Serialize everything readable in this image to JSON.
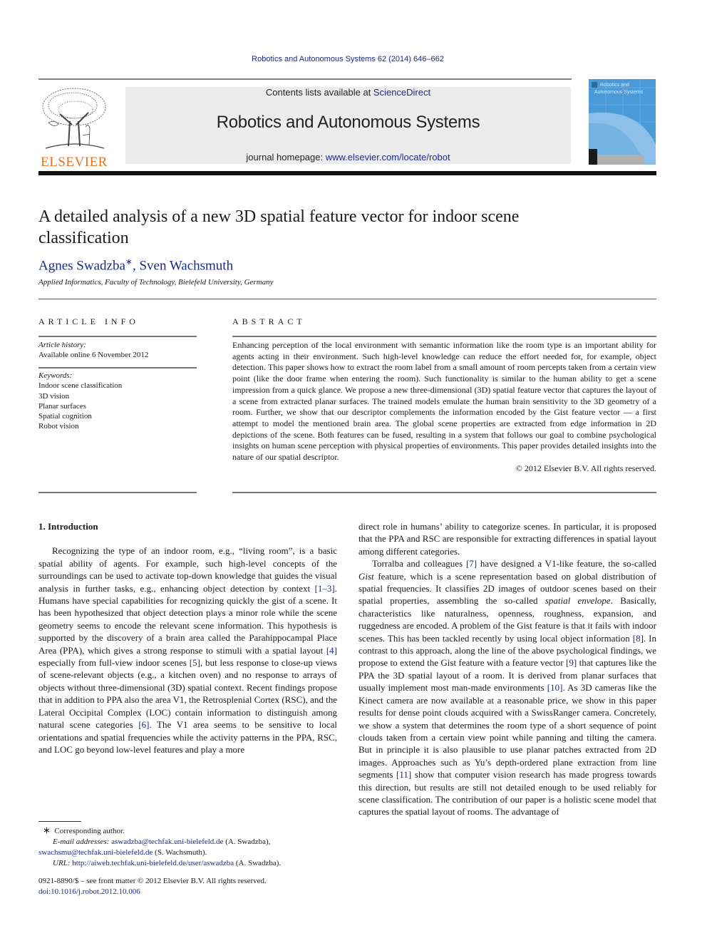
{
  "header": {
    "journal_reference": "Robotics and Autonomous Systems 62 (2014) 646–662",
    "contents_prefix": "Contents lists available at ",
    "contents_link": "ScienceDirect",
    "journal_title": "Robotics and Autonomous Systems",
    "homepage_prefix": "journal homepage: ",
    "homepage_link": "www.elsevier.com/locate/robot",
    "publisher_logo_text": "ELSEVIER",
    "cover_title_line1": "Robotics and",
    "cover_title_line2": "Autonomous Systems"
  },
  "article": {
    "title": "A detailed analysis of a new 3D spatial feature vector for indoor scene classification",
    "authors": [
      {
        "name": "Agnes Swadzba",
        "mark": "∗"
      },
      {
        "name": "Sven Wachsmuth",
        "mark": ""
      }
    ],
    "author_separator": ", ",
    "affiliation": "Applied Informatics, Faculty of Technology, Bielefeld University, Germany"
  },
  "article_info": {
    "heading": "ARTICLE INFO",
    "history_label": "Article history:",
    "history_value": "Available online 6 November 2012",
    "keywords_label": "Keywords:",
    "keywords": [
      "Indoor scene classification",
      "3D vision",
      "Planar surfaces",
      "Spatial cognition",
      "Robot vision"
    ]
  },
  "abstract": {
    "heading": "ABSTRACT",
    "text": "Enhancing perception of the local environment with semantic information like the room type is an important ability for agents acting in their environment. Such high-level knowledge can reduce the effort needed for, for example, object detection. This paper shows how to extract the room label from a small amount of room percepts taken from a certain view point (like the door frame when entering the room). Such functionality is similar to the human ability to get a scene impression from a quick glance. We propose a new three-dimensional (3D) spatial feature vector that captures the layout of a scene from extracted planar surfaces. The trained models emulate the human brain sensitivity to the 3D geometry of a room. Further, we show that our descriptor complements the information encoded by the Gist feature vector — a first attempt to model the mentioned brain area. The global scene properties are extracted from edge information in 2D depictions of the scene. Both features can be fused, resulting in a system that follows our goal to combine psychological insights on human scene perception with physical properties of environments. This paper provides detailed insights into the nature of our spatial descriptor.",
    "copyright": "© 2012 Elsevier B.V. All rights reserved."
  },
  "body": {
    "section_title": "1.  Introduction",
    "left_paragraph": [
      {
        "t": "Recognizing the type of an indoor room, e.g., “living room”, is a basic spatial ability of agents. For example, such high-level concepts of the surroundings can be used to activate top-down knowledge that guides the visual analysis in further tasks, e.g., enhancing object detection by context "
      },
      {
        "r": "[1–3]"
      },
      {
        "t": ". Humans have special capabilities for recognizing quickly the gist of a scene. It has been hypothesized that object detection plays a minor role while the scene geometry seems to encode the relevant scene information. This hypothesis is supported by the discovery of a brain area called the Parahippocampal Place Area (PPA), which gives a strong response to stimuli with a spatial layout "
      },
      {
        "r": "[4]"
      },
      {
        "t": " especially from full-view indoor scenes "
      },
      {
        "r": "[5]"
      },
      {
        "t": ", but less response to close-up views of scene-relevant objects (e.g., a kitchen oven) and no response to arrays of objects without three-dimensional (3D) spatial context. Recent findings propose that in addition to PPA also the area V1, the Retrosplenial Cortex (RSC), and the Lateral Occipital Complex (LOC) contain information to distinguish among natural scene categories "
      },
      {
        "r": "[6]"
      },
      {
        "t": ". The V1 area seems to be sensitive to local orientations and spatial frequencies while the activity patterns in the PPA, RSC, and LOC go beyond low-level features and play a more"
      }
    ],
    "right_paragraph_1": "direct role in humans’ ability to categorize scenes. In particular, it is proposed that the PPA and RSC are responsible for extracting differences in spatial layout among different categories.",
    "right_paragraph_2": [
      {
        "t": "Torralba and colleagues "
      },
      {
        "r": "[7]"
      },
      {
        "t": " have designed a V1-like feature, the so-called "
      },
      {
        "i": "Gist"
      },
      {
        "t": " feature, which is a scene representation based on global distribution of spatial frequencies. It classifies 2D images of outdoor scenes based on their spatial properties, assembling the so-called "
      },
      {
        "i": "spatial envelope"
      },
      {
        "t": ". Basically, characteristics like naturalness, openness, roughness, expansion, and ruggedness are encoded. A problem of the Gist feature is that it fails with indoor scenes. This has been tackled recently by using local object information "
      },
      {
        "r": "[8]"
      },
      {
        "t": ". In contrast to this approach, along the line of the above psychological findings, we propose to extend the Gist feature with a feature vector "
      },
      {
        "r": "[9]"
      },
      {
        "t": " that captures like the PPA the 3D spatial layout of a room. It is derived from planar surfaces that usually implement most man-made environments "
      },
      {
        "r": "[10]"
      },
      {
        "t": ". As 3D cameras like the Kinect camera are now available at a reasonable price, we show in this paper results for dense point clouds acquired with a SwissRanger camera. Concretely, we show a system that determines the room type of a short sequence of point clouds taken from a certain view point while panning and tilting the camera. But in principle it is also plausible to use planar patches extracted from 2D images. Approaches such as Yu’s depth-ordered plane extraction from line segments "
      },
      {
        "r": "[11]"
      },
      {
        "t": " show that computer vision research has made progress towards this direction, but results are still not detailed enough to be used reliably for scene classification. The contribution of our paper is a holistic scene model that captures the spatial layout of rooms. The advantage of"
      }
    ]
  },
  "footnotes": {
    "mark": "∗",
    "corresponding": "Corresponding author.",
    "email_label": "E-mail addresses:",
    "email_1": "aswadzba@techfak.uni-bielefeld.de",
    "email_1_owner": " (A. Swadzba),",
    "email_2": "swachsmu@techfak.uni-bielefeld.de",
    "email_2_owner": " (S. Wachsmuth).",
    "url_label": "URL:",
    "url": "http://aiweb.techfak.uni-bielefeld.de/user/aswadzba",
    "url_owner": " (A. Swadzba).",
    "front_matter": "0921-8890/$ – see front matter © 2012 Elsevier B.V. All rights reserved.",
    "doi": "doi:10.1016/j.robot.2012.10.006"
  },
  "colors": {
    "link": "#1a2a8c",
    "elsevier_orange": "#e9711c",
    "banner_bg": "#ececec",
    "cover_blue": "#4a9ad8"
  }
}
